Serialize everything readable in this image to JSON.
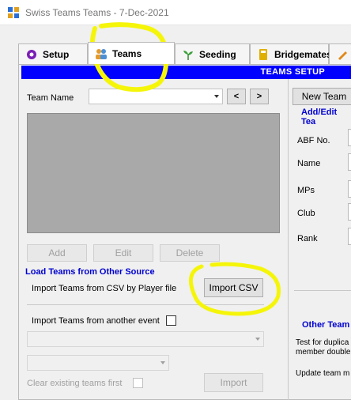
{
  "window": {
    "title": "Swiss Teams Teams - 7-Dec-2021"
  },
  "tabs": [
    {
      "label": "Setup",
      "icon": "gear-icon"
    },
    {
      "label": "Teams",
      "icon": "people-icon"
    },
    {
      "label": "Seeding",
      "icon": "seedling-icon"
    },
    {
      "label": "Bridgemates",
      "icon": "calculator-icon"
    }
  ],
  "header": {
    "title": "TEAMS SETUP"
  },
  "team_name": {
    "label": "Team Name",
    "value": ""
  },
  "nav": {
    "prev": "<",
    "next": ">"
  },
  "new_team_button": "New Team",
  "grid_actions": {
    "add": "Add",
    "edit": "Edit",
    "delete": "Delete"
  },
  "add_edit": {
    "title": "Add/Edit Tea",
    "fields": [
      "ABF No.",
      "Name",
      "MPs",
      "Club",
      "Rank"
    ]
  },
  "load_section": {
    "title": "Load Teams from Other Source",
    "csv_label": "Import Teams from CSV by Player file",
    "csv_button": "Import CSV",
    "other_event_label": "Import Teams from another event",
    "clear_label": "Clear existing teams first",
    "import_button": "Import"
  },
  "other_section": {
    "title": "Other Team",
    "duplicates_text_1": "Test for duplica",
    "duplicates_text_2": "member double",
    "update_text": "Update team m"
  },
  "annotation": {
    "color": "#f5f50a"
  }
}
